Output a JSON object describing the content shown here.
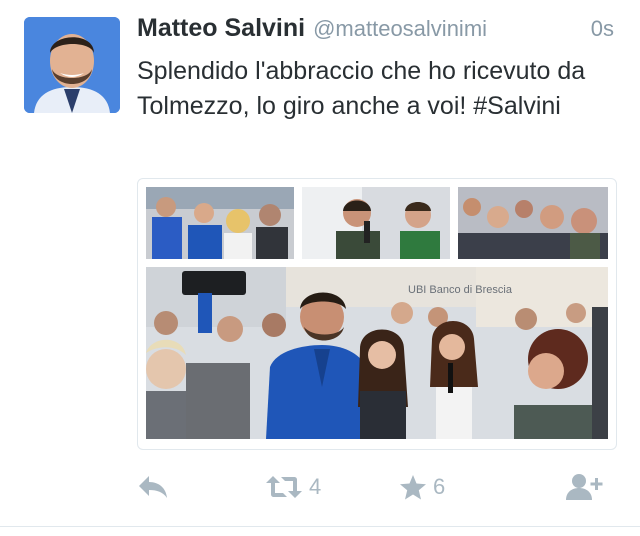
{
  "tweet": {
    "author_name": "Matteo Salvini",
    "author_handle": "@matteosalvinimi",
    "timestamp": "0s",
    "text_main": "Splendido l'abbraccio che ho ricevuto da Tolmezzo, lo giro anche a voi! ",
    "hashtag": "#Salvini",
    "media_sign": "UBI Banco di Brescia"
  },
  "actions": {
    "reply_icon": "reply-icon",
    "retweet_icon": "retweet-icon",
    "retweet_count": "4",
    "favorite_icon": "star-icon",
    "favorite_count": "6",
    "follow_icon": "follow-user-icon"
  },
  "colors": {
    "text": "#292f33",
    "meta": "#8899a6",
    "action": "#aab8c2",
    "jacket_blue": "#1f56b8"
  }
}
